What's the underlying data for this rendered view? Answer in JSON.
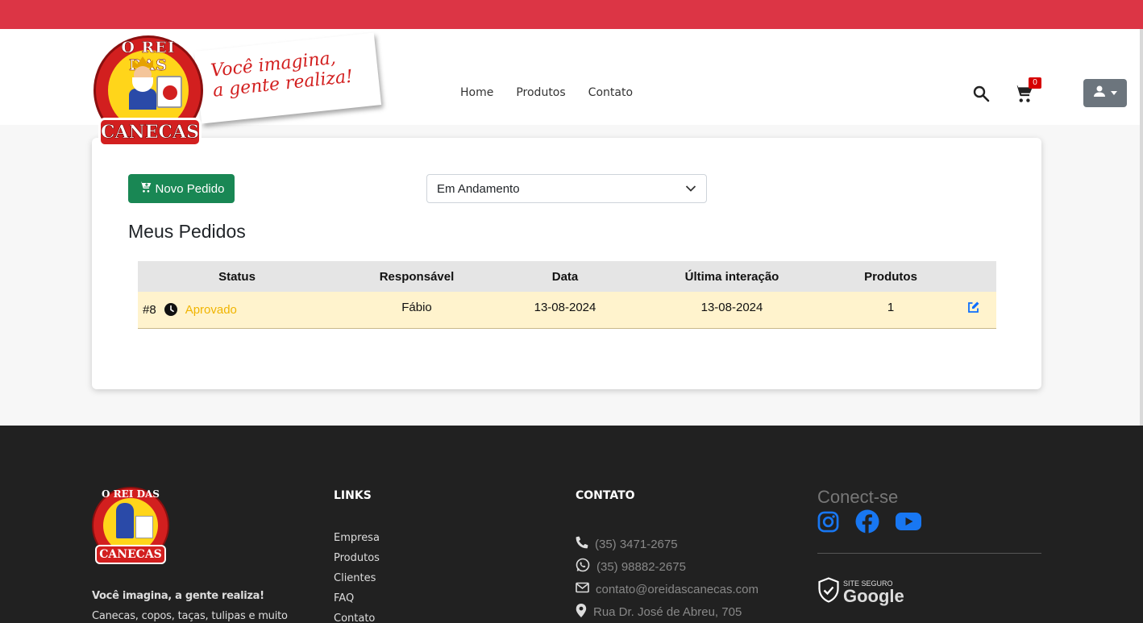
{
  "brand": {
    "logo_top": "O REI DAS",
    "logo_bottom": "CANECAS",
    "tagline_line1": "Você imagina,",
    "tagline_line2": "a gente realiza!"
  },
  "nav": {
    "items": [
      {
        "label": "Home"
      },
      {
        "label": "Produtos"
      },
      {
        "label": "Contato"
      }
    ]
  },
  "header_actions": {
    "search_icon": "search-icon",
    "cart_icon": "cart-icon",
    "cart_count": "0",
    "user_icon": "user-icon"
  },
  "orders": {
    "new_order_label": "Novo Pedido",
    "filter_selected": "Em Andamento",
    "title": "Meus Pedidos",
    "columns": [
      "Status",
      "Responsável",
      "Data",
      "Última interação",
      "Produtos"
    ],
    "rows": [
      {
        "id": "#8",
        "status": "Aprovado",
        "status_color": "#f0b400",
        "responsavel": "Fábio",
        "data": "13-08-2024",
        "ultima_interacao": "13-08-2024",
        "produtos": "1"
      }
    ]
  },
  "footer": {
    "logo_top": "O REI DAS",
    "logo_bottom": "CANECAS",
    "slogan": "Você imagina, a gente realiza!",
    "description": "Canecas, copos, taças, tulipas e muito",
    "links_title": "LINKS",
    "links": [
      "Empresa",
      "Produtos",
      "Clientes",
      "FAQ",
      "Contato"
    ],
    "contact_title": "CONTATO",
    "contact": [
      {
        "icon": "phone-icon",
        "text": "(35) 3471-2675"
      },
      {
        "icon": "whatsapp-icon",
        "text": "(35) 98882-2675"
      },
      {
        "icon": "envelope-icon",
        "text": "contato@oreidascanecas.com"
      },
      {
        "icon": "map-pin-icon",
        "text": "Rua Dr. José de Abreu, 705"
      }
    ],
    "social_title": "Conect-se",
    "social": [
      "instagram-icon",
      "facebook-icon",
      "youtube-icon"
    ],
    "safe_top": "SITE SEGURO",
    "safe_brand": "Google"
  },
  "colors": {
    "topbar": "#dc3545",
    "primary_button": "#198754",
    "row_highlight": "#fff3cd",
    "social_blue": "#1877f2",
    "footer_bg": "#212121"
  }
}
